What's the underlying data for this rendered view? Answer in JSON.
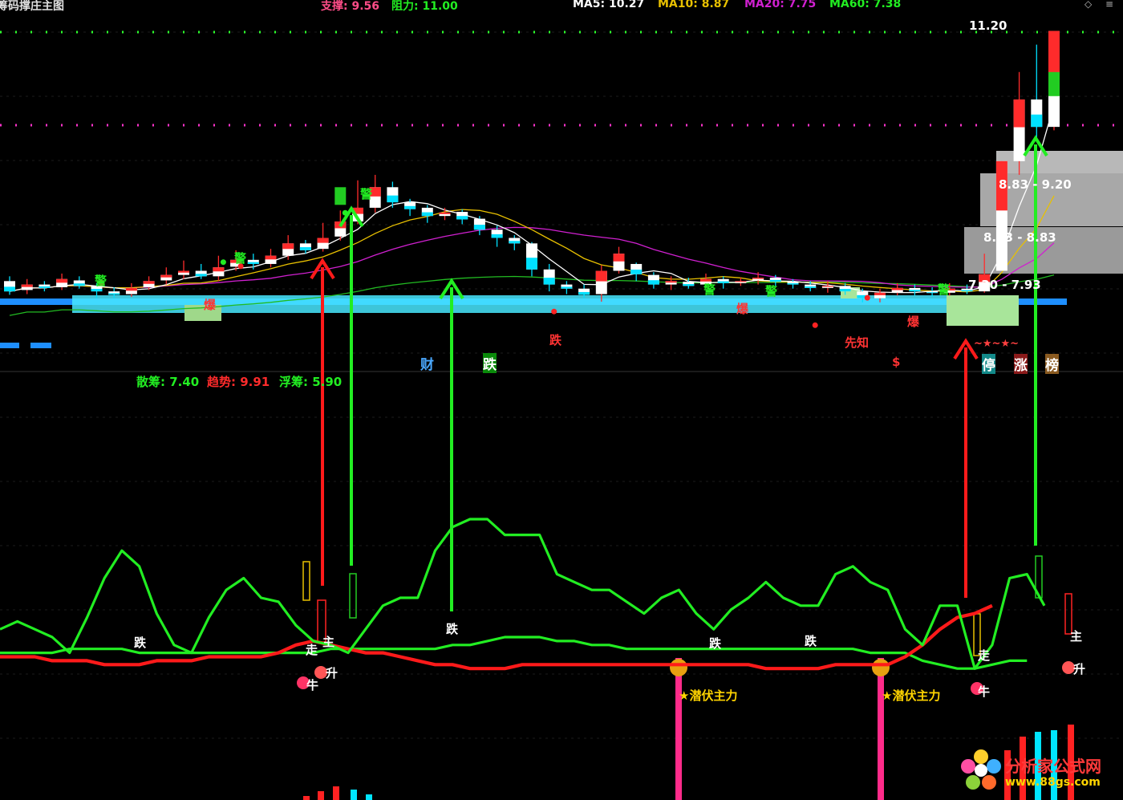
{
  "window": {
    "title": "筹码撑庄主图"
  },
  "header": {
    "support_label": "支撑: 9.56",
    "resist_label": "阻力: 11.00",
    "ma5_label": "MA5: 10.27",
    "ma10_label": "MA10: 8.87",
    "ma20_label": "MA20: 7.75",
    "ma60_label": "MA60: 7.38",
    "close_icon": "diamond-close-icon",
    "menu_icon": "menu-lines-icon"
  },
  "colors": {
    "up": "#ff2b2b",
    "down": "#00e0ff",
    "ma5": "#ffffff",
    "ma10": "#e8c000",
    "ma20": "#d020d0",
    "ma60": "#22bb22",
    "green": "#22ee22",
    "red": "#ff1a1a",
    "yellow": "#ffd400",
    "magenta": "#ff3399",
    "cyan": "#00e5ff",
    "blue": "#1e8fff"
  },
  "main_panel": {
    "high_price_label": "11.20",
    "zone1_label": "8.83 - 9.20",
    "zone2_label": "8.03 - 8.83",
    "zone3_label": "7.30 - 7.93",
    "marker_jing": "警",
    "marker_bao": "爆",
    "marker_die": "跌",
    "marker_xianzhi": "先知",
    "marker_cai": "财",
    "marker_dollar": "$",
    "stars": "~★~★~",
    "ting_label": "停",
    "zhang_label": "涨",
    "bang_label": "榜"
  },
  "sub_panel": {
    "sanchou_label": "散筹: 7.40",
    "qushi_label": "趋势: 9.91",
    "fuchou_label": "浮筹: 5.90",
    "die_label": "跌",
    "zou_label": "走",
    "zhu_label": "主",
    "sheng_label": "升",
    "niu_label": "牛",
    "qianfu_label": "★潜伏主力"
  },
  "watermark": {
    "title": "分析家公式网",
    "url": "www.88gs.com"
  },
  "chart_data": [
    {
      "type": "candlestick",
      "title": "筹码撑庄主图",
      "support": 9.56,
      "resistance": 11.0,
      "ma": {
        "MA5": 10.27,
        "MA10": 8.87,
        "MA20": 7.75,
        "MA60": 7.38
      },
      "last_high": 11.2,
      "price_zones": [
        [
          8.83,
          9.2
        ],
        [
          8.03,
          8.83
        ],
        [
          7.3,
          7.93
        ]
      ],
      "ylim": [
        6.5,
        11.3
      ],
      "candles": [
        [
          7.55,
          7.4,
          7.62,
          7.35
        ],
        [
          7.42,
          7.5,
          7.58,
          7.36
        ],
        [
          7.5,
          7.45,
          7.55,
          7.4
        ],
        [
          7.46,
          7.58,
          7.66,
          7.42
        ],
        [
          7.56,
          7.48,
          7.62,
          7.44
        ],
        [
          7.48,
          7.4,
          7.52,
          7.3
        ],
        [
          7.4,
          7.35,
          7.46,
          7.3
        ],
        [
          7.36,
          7.45,
          7.52,
          7.32
        ],
        [
          7.46,
          7.55,
          7.62,
          7.42
        ],
        [
          7.56,
          7.64,
          7.75,
          7.5
        ],
        [
          7.64,
          7.7,
          7.85,
          7.58
        ],
        [
          7.7,
          7.62,
          7.8,
          7.58
        ],
        [
          7.62,
          7.75,
          7.92,
          7.55
        ],
        [
          7.76,
          7.86,
          8.0,
          7.7
        ],
        [
          7.86,
          7.8,
          7.95,
          7.72
        ],
        [
          7.8,
          7.92,
          8.02,
          7.75
        ],
        [
          7.92,
          8.1,
          8.22,
          7.86
        ],
        [
          8.1,
          8.0,
          8.15,
          7.95
        ],
        [
          8.02,
          8.18,
          8.4,
          7.98
        ],
        [
          8.2,
          8.42,
          8.58,
          8.14
        ],
        [
          8.42,
          8.62,
          9.02,
          8.38
        ],
        [
          8.62,
          8.92,
          9.1,
          8.55
        ],
        [
          8.92,
          8.7,
          9.0,
          8.62
        ],
        [
          8.7,
          8.6,
          8.75,
          8.5
        ],
        [
          8.62,
          8.5,
          8.66,
          8.4
        ],
        [
          8.5,
          8.55,
          8.62,
          8.44
        ],
        [
          8.56,
          8.45,
          8.6,
          8.38
        ],
        [
          8.46,
          8.3,
          8.5,
          8.22
        ],
        [
          8.3,
          8.18,
          8.36,
          8.05
        ],
        [
          8.18,
          8.1,
          8.22,
          8.0
        ],
        [
          8.1,
          7.72,
          8.12,
          7.62
        ],
        [
          7.72,
          7.5,
          7.8,
          7.4
        ],
        [
          7.5,
          7.44,
          7.55,
          7.36
        ],
        [
          7.44,
          7.35,
          7.5,
          7.3
        ],
        [
          7.36,
          7.7,
          7.78,
          7.25
        ],
        [
          7.7,
          7.95,
          8.05,
          7.66
        ],
        [
          7.8,
          7.65,
          7.82,
          7.55
        ],
        [
          7.64,
          7.5,
          7.68,
          7.44
        ],
        [
          7.5,
          7.55,
          7.62,
          7.42
        ],
        [
          7.54,
          7.48,
          7.6,
          7.44
        ],
        [
          7.5,
          7.58,
          7.66,
          7.46
        ],
        [
          7.58,
          7.52,
          7.62,
          7.44
        ],
        [
          7.52,
          7.55,
          7.6,
          7.48
        ],
        [
          7.56,
          7.6,
          7.68,
          7.5
        ],
        [
          7.6,
          7.54,
          7.64,
          7.48
        ],
        [
          7.54,
          7.5,
          7.58,
          7.44
        ],
        [
          7.5,
          7.45,
          7.55,
          7.4
        ],
        [
          7.45,
          7.48,
          7.55,
          7.38
        ],
        [
          7.48,
          7.4,
          7.52,
          7.35
        ],
        [
          7.4,
          7.3,
          7.44,
          7.24
        ],
        [
          7.3,
          7.38,
          7.44,
          7.24
        ],
        [
          7.38,
          7.45,
          7.52,
          7.34
        ],
        [
          7.45,
          7.4,
          7.5,
          7.34
        ],
        [
          7.4,
          7.38,
          7.46,
          7.32
        ],
        [
          7.38,
          7.44,
          7.52,
          7.34
        ],
        [
          7.44,
          7.4,
          7.5,
          7.36
        ],
        [
          7.4,
          7.65,
          7.95,
          7.38
        ],
        [
          7.7,
          9.3,
          9.3,
          7.7
        ],
        [
          9.3,
          10.2,
          10.6,
          9.1
        ],
        [
          10.2,
          9.8,
          11.0,
          9.6
        ],
        [
          9.8,
          11.2,
          11.2,
          9.75
        ]
      ]
    },
    {
      "type": "line",
      "title": "",
      "series": [
        {
          "name": "散筹",
          "last": 7.4,
          "color": "#22ee22",
          "values": [
            42,
            44,
            42,
            40,
            36,
            45,
            55,
            62,
            58,
            46,
            38,
            36,
            45,
            52,
            55,
            50,
            49,
            43,
            39,
            38,
            36,
            42,
            48,
            50,
            50,
            62,
            68,
            70,
            70,
            66,
            66,
            66,
            56,
            54,
            52,
            52,
            49,
            46,
            50,
            52,
            46,
            42,
            47,
            50,
            54,
            50,
            48,
            48,
            56,
            58,
            54,
            52,
            42,
            38,
            48,
            48,
            32,
            38,
            55,
            56,
            48
          ]
        },
        {
          "name": "趋势",
          "last": 9.91,
          "color": "#ff1a1a",
          "values": [
            35,
            35,
            35,
            34,
            34,
            34,
            33,
            33,
            33,
            34,
            34,
            34,
            35,
            35,
            35,
            35,
            36,
            38,
            39,
            38,
            37,
            36,
            36,
            35,
            34,
            33,
            33,
            32,
            32,
            32,
            33,
            33,
            33,
            33,
            33,
            33,
            33,
            33,
            33,
            33,
            33,
            33,
            33,
            33,
            32,
            32,
            32,
            32,
            33,
            33,
            33,
            33,
            35,
            38,
            42,
            45,
            46,
            48
          ]
        },
        {
          "name": "浮筹",
          "last": 5.9,
          "color": "#22ee22",
          "values": [
            36,
            36,
            36,
            36,
            37,
            37,
            37,
            37,
            36,
            36,
            36,
            36,
            36,
            36,
            36,
            36,
            36,
            36,
            36,
            37,
            37,
            37,
            37,
            37,
            37,
            37,
            38,
            38,
            39,
            40,
            40,
            40,
            39,
            39,
            38,
            38,
            37,
            37,
            37,
            37,
            37,
            37,
            37,
            37,
            37,
            37,
            37,
            37,
            37,
            37,
            36,
            36,
            36,
            34,
            33,
            32,
            32,
            33,
            34,
            34
          ]
        }
      ],
      "ylim": [
        0,
        100
      ]
    }
  ]
}
